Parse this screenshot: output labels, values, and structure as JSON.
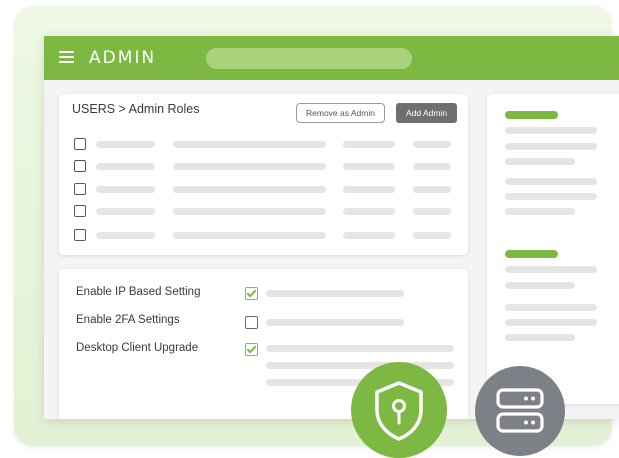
{
  "header": {
    "title": "ADMIN",
    "search_placeholder": ""
  },
  "users_panel": {
    "breadcrumb": "USERS > Admin Roles",
    "remove_button": "Remove as Admin",
    "add_button": "Add Admin",
    "rows": [
      {
        "checked": false
      },
      {
        "checked": false
      },
      {
        "checked": false
      },
      {
        "checked": false
      },
      {
        "checked": false
      }
    ]
  },
  "settings_panel": {
    "items": [
      {
        "label": "Enable IP Based Setting",
        "checked": true
      },
      {
        "label": "Enable 2FA Settings",
        "checked": false
      },
      {
        "label": "Desktop Client Upgrade",
        "checked": true
      }
    ]
  },
  "colors": {
    "brand_green": "#7cb842",
    "search_green": "#a8d27c",
    "button_gray": "#6f6f6f",
    "server_gray": "#7d8087"
  },
  "icons": [
    "hamburger-menu-icon",
    "shield-keyhole-icon",
    "server-stack-icon"
  ]
}
